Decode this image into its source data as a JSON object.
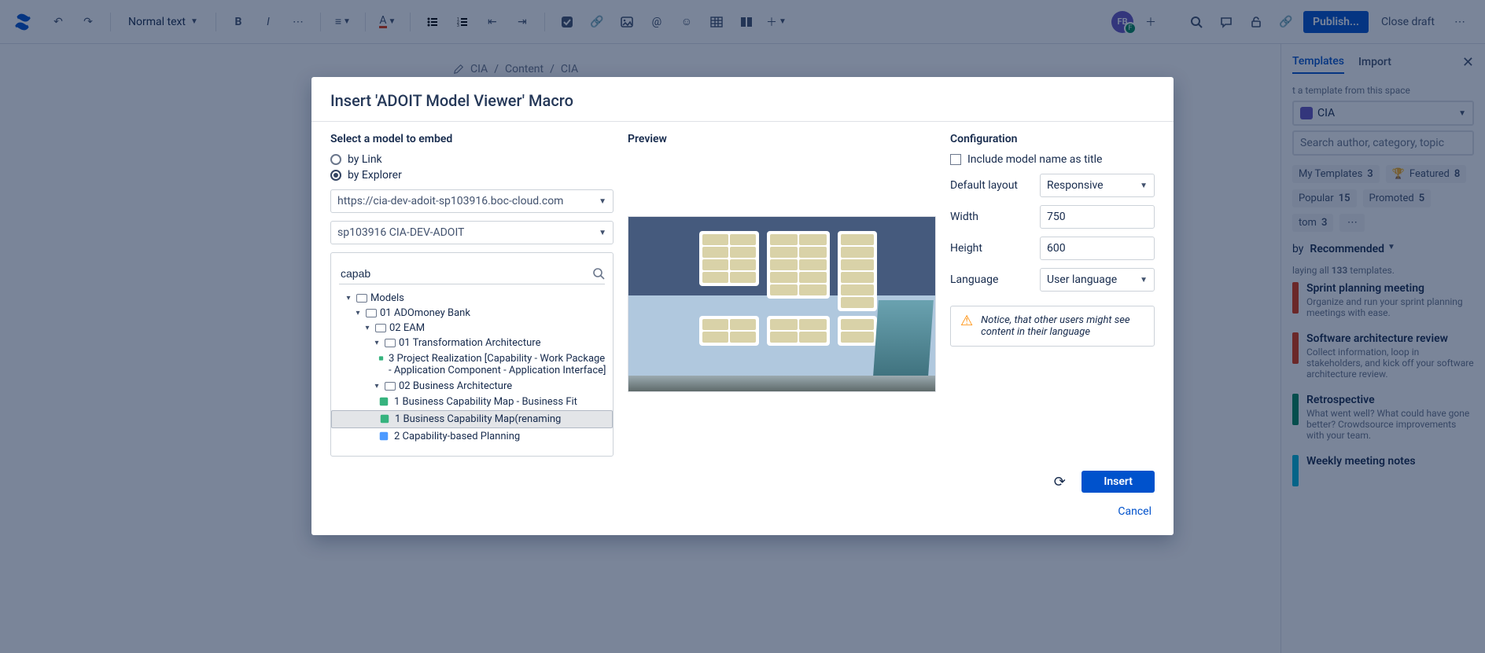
{
  "toolbar": {
    "text_style": "Normal text",
    "publish": "Publish...",
    "close_draft": "Close draft",
    "avatar_initials": "FB",
    "avatar_badge": "F"
  },
  "breadcrumb": {
    "space": "CIA",
    "parent": "Content",
    "page": "CIA"
  },
  "templates": {
    "tab_templates": "Templates",
    "tab_import": "Import",
    "pick_label": "t a template from this space",
    "space_name": "CIA",
    "search_placeholder": "Search author, category, topic",
    "filters": [
      {
        "label": "My Templates",
        "count": "3"
      },
      {
        "label": "Featured",
        "count": "8",
        "star": true
      },
      {
        "label": "Popular",
        "count": "15"
      },
      {
        "label": "Promoted",
        "count": "5"
      },
      {
        "label": "tom",
        "count": "3"
      }
    ],
    "sort_by_label": "by",
    "sort_selected": "Recommended",
    "display_text_a": "laying all ",
    "display_count": "133",
    "display_text_b": " templates.",
    "items": [
      {
        "title": "Sprint planning meeting",
        "desc": "Organize and run your sprint planning meetings with ease.",
        "color": "red"
      },
      {
        "title": "Software architecture review",
        "desc": "Collect information, loop in stakeholders, and kick off your software architecture review.",
        "color": "red"
      },
      {
        "title": "Retrospective",
        "desc": "What went well? What could have gone better? Crowdsource improvements with your team.",
        "color": "green"
      },
      {
        "title": "Weekly meeting notes",
        "desc": "",
        "color": "teal"
      }
    ]
  },
  "modal": {
    "title": "Insert 'ADOIT Model Viewer' Macro",
    "select_label": "Select a model to embed",
    "radio_link": "by Link",
    "radio_explorer": "by Explorer",
    "url": "https://cia-dev-adoit-sp103916.boc-cloud.com",
    "repo": "sp103916 CIA-DEV-ADOIT",
    "search_value": "capab",
    "tree": {
      "root": "Models",
      "l1": "01 ADOmoney Bank",
      "l2": "02 EAM",
      "l3a": "01 Transformation Architecture",
      "leaf1": "3 Project Realization [Capability - Work Package - Application Component - Application Interface]",
      "l3b": "02 Business Architecture",
      "leaf2": "1 Business Capability Map - Business Fit",
      "leaf3": "1 Business Capability Map(renaming",
      "leaf4": "2 Capability-based Planning"
    },
    "preview_label": "Preview",
    "config": {
      "label": "Configuration",
      "include_title": "Include model name as title",
      "layout_label": "Default layout",
      "layout_value": "Responsive",
      "width_label": "Width",
      "width_value": "750",
      "height_label": "Height",
      "height_value": "600",
      "language_label": "Language",
      "language_value": "User language",
      "notice": "Notice, that other users might see content in their language"
    },
    "insert": "Insert",
    "cancel": "Cancel"
  }
}
